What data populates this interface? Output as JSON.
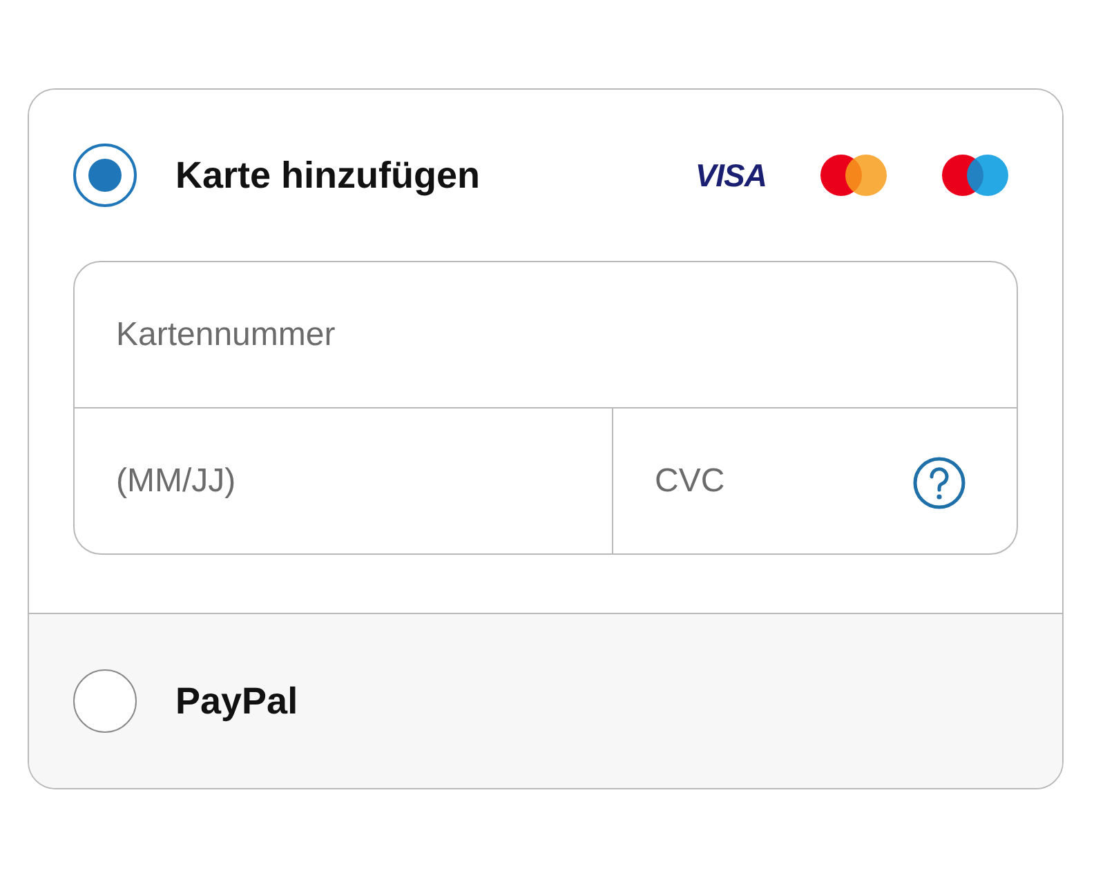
{
  "payment_options": [
    {
      "kind": "card",
      "label": "Karte hinzufügen",
      "selected": true,
      "brand_text": "VISA",
      "fields": {
        "card_number": {
          "placeholder": "Kartennummer"
        },
        "expiry": {
          "placeholder": "(MM/JJ)"
        },
        "cvc": {
          "placeholder": "CVC"
        }
      }
    },
    {
      "kind": "paypal",
      "label": "PayPal",
      "selected": false
    }
  ]
}
